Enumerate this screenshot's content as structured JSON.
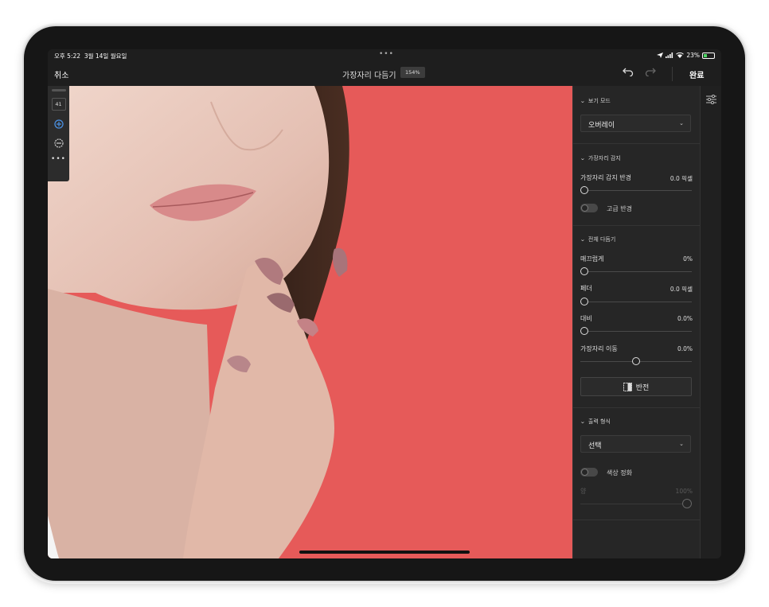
{
  "status_bar": {
    "time": "오후 5:22",
    "date": "3월 14일 월요일",
    "dots": "•••",
    "battery_percent": "23%"
  },
  "toolbar": {
    "cancel_label": "취소",
    "title": "가장자리 다듬기",
    "zoom": "154%",
    "done_label": "완료"
  },
  "tools": {
    "brush_size": "41"
  },
  "panel": {
    "view_mode": {
      "heading": "보기 모드",
      "selected": "오버레이"
    },
    "edge_detection": {
      "heading": "가장자리 감지",
      "radius_label": "가장자리 감지 반경",
      "radius_value": "0.0 픽셀",
      "radius_level": 0,
      "advanced_radius_label": "고급 반경"
    },
    "global_refine": {
      "heading": "전체 다듬기",
      "smooth_label": "매끄럽게",
      "smooth_value": "0%",
      "smooth_level": 0,
      "feather_label": "페더",
      "feather_value": "0.0 픽셀",
      "feather_level": 0,
      "contrast_label": "대비",
      "contrast_value": "0.0%",
      "contrast_level": 0,
      "shift_edge_label": "가장자리 이동",
      "shift_edge_value": "0.0%",
      "shift_edge_level": 0.5,
      "invert_label": "반전"
    },
    "output": {
      "heading": "출력 형식",
      "selected": "선택",
      "decontaminate_label": "색상 정화",
      "amount_label": "양",
      "amount_value": "100%",
      "amount_level": 1
    }
  },
  "colors": {
    "canvas_overlay": "#e65a59",
    "panel_bg": "#262626",
    "accent_blue": "#4a90e2"
  }
}
